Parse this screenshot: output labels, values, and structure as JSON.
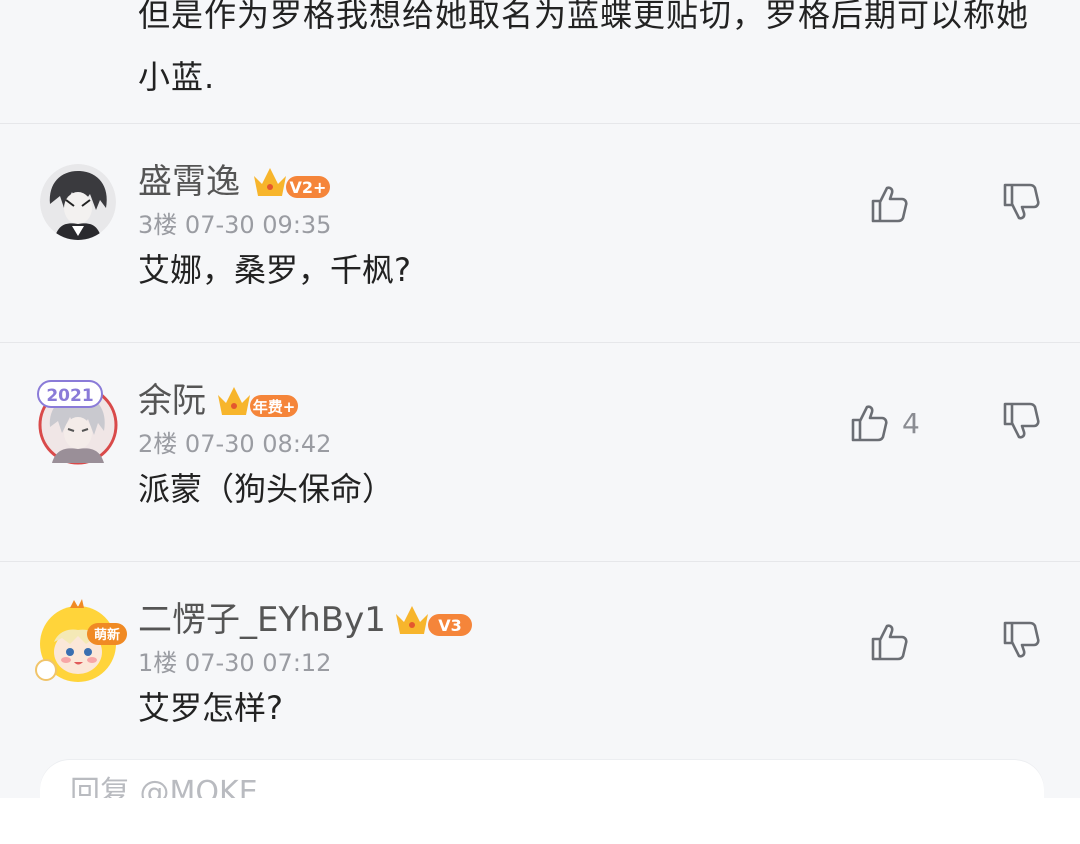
{
  "previous_comment": {
    "text": "但是作为罗格我想给她取名为蓝蝶更贴切，罗格后期可以称她小蓝."
  },
  "comments": [
    {
      "username": "盛霄逸",
      "level_badge": "V2+",
      "floor": "3楼",
      "time": "07-30 09:35",
      "text": "艾娜，桑罗，千枫?",
      "like_count": "",
      "avatar_icon": "anime-boy-avatar-icon"
    },
    {
      "username": "余阮",
      "level_badge": "年费+",
      "avatar_badge": "2021",
      "floor": "2楼",
      "time": "07-30 08:42",
      "text": "派蒙（狗头保命）",
      "like_count": "4",
      "avatar_icon": "anime-silver-hair-avatar-icon"
    },
    {
      "username": "二愣子_EYhBy1",
      "level_badge": "V3",
      "avatar_badge": "萌新",
      "floor": "1楼",
      "time": "07-30 07:12",
      "text": "艾罗怎样?",
      "like_count": "",
      "avatar_icon": "chick-hood-avatar-icon"
    }
  ],
  "reply": {
    "placeholder": "回复 @MOKE"
  },
  "colors": {
    "background": "#f6f7f9",
    "crown": "#f7b52c",
    "badge_orange": "#f5853a",
    "text_primary": "#222222",
    "text_meta": "#9a9ca2"
  }
}
